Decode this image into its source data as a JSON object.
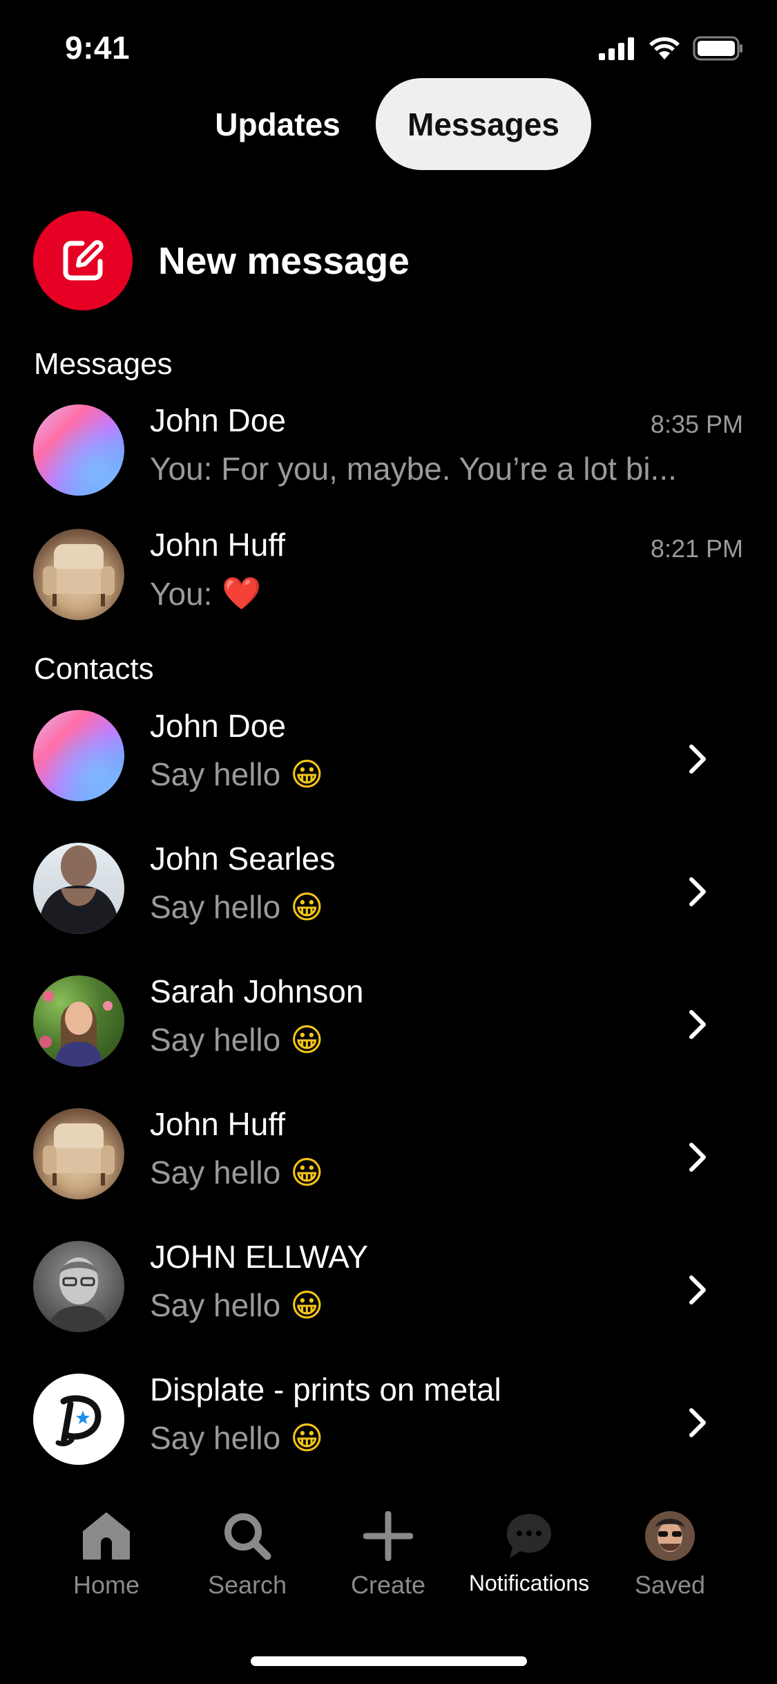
{
  "status_bar": {
    "time": "9:41"
  },
  "tabs": [
    {
      "label": "Updates",
      "active": false
    },
    {
      "label": "Messages",
      "active": true
    }
  ],
  "new_message": {
    "label": "New message"
  },
  "sections": {
    "messages_title": "Messages",
    "contacts_title": "Contacts"
  },
  "messages": [
    {
      "name": "John Doe",
      "preview": "You: For you, maybe. You’re a lot bi...",
      "time": "8:35 PM"
    },
    {
      "name": "John Huff",
      "preview": "You:",
      "preview_emoji": "❤️",
      "time": "8:21 PM"
    }
  ],
  "contacts": [
    {
      "name": "John Doe",
      "action": "Say hello",
      "emoji": "😀"
    },
    {
      "name": "John Searles",
      "action": "Say hello",
      "emoji": "😀"
    },
    {
      "name": "Sarah Johnson",
      "action": "Say hello",
      "emoji": "😀"
    },
    {
      "name": "John Huff",
      "action": "Say hello",
      "emoji": "😀"
    },
    {
      "name": "JOHN ELLWAY",
      "action": "Say hello",
      "emoji": "😀"
    },
    {
      "name": "Displate - prints on metal",
      "action": "Say hello",
      "emoji": "😀"
    }
  ],
  "bottom_nav": [
    {
      "label": "Home",
      "icon": "home-icon",
      "active": false
    },
    {
      "label": "Search",
      "icon": "search-icon",
      "active": false
    },
    {
      "label": "Create",
      "icon": "plus-icon",
      "active": false
    },
    {
      "label": "Notifications",
      "icon": "chat-bubble-icon",
      "active": true
    },
    {
      "label": "Saved",
      "icon": "profile-avatar",
      "active": false
    }
  ],
  "colors": {
    "background": "#000000",
    "accent": "#e60023",
    "active_tab_bg": "#efefef",
    "secondary_text": "#9a9a9a"
  }
}
